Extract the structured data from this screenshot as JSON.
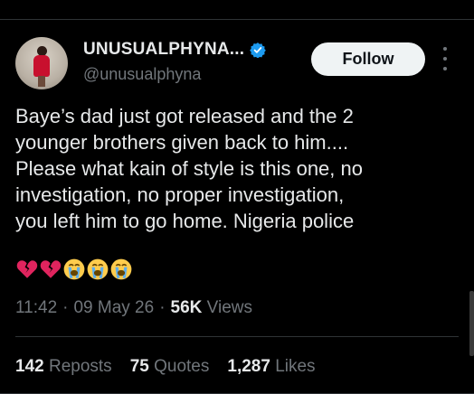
{
  "author": {
    "display_name": "UNUSUALPHYNA...",
    "handle": "@unusualphyna",
    "verified_icon": "verified-badge-icon"
  },
  "follow_label": "Follow",
  "tweet": {
    "text": "Baye’s dad just got released and the 2\nyounger brothers given back to him....\nPlease what kain of style is this one, no\ninvestigation, no proper investigation,\nyou left him to go home. Nigeria police",
    "emojis": [
      "broken-heart-icon",
      "broken-heart-icon",
      "crying-face-icon",
      "crying-face-icon",
      "crying-face-icon"
    ]
  },
  "meta": {
    "time": "11:42",
    "sep1": "·",
    "date": "09 May 26",
    "sep2": "·",
    "views_count": "56K",
    "views_label": "Views"
  },
  "stats": {
    "reposts_count": "142",
    "reposts_label": "Reposts",
    "quotes_count": "75",
    "quotes_label": "Quotes",
    "likes_count": "1,287",
    "likes_label": "Likes"
  },
  "colors": {
    "background": "#000000",
    "text": "#e7e9ea",
    "muted": "#71767b",
    "verified": "#1d9bf0",
    "follow_bg": "#eff3f4"
  }
}
